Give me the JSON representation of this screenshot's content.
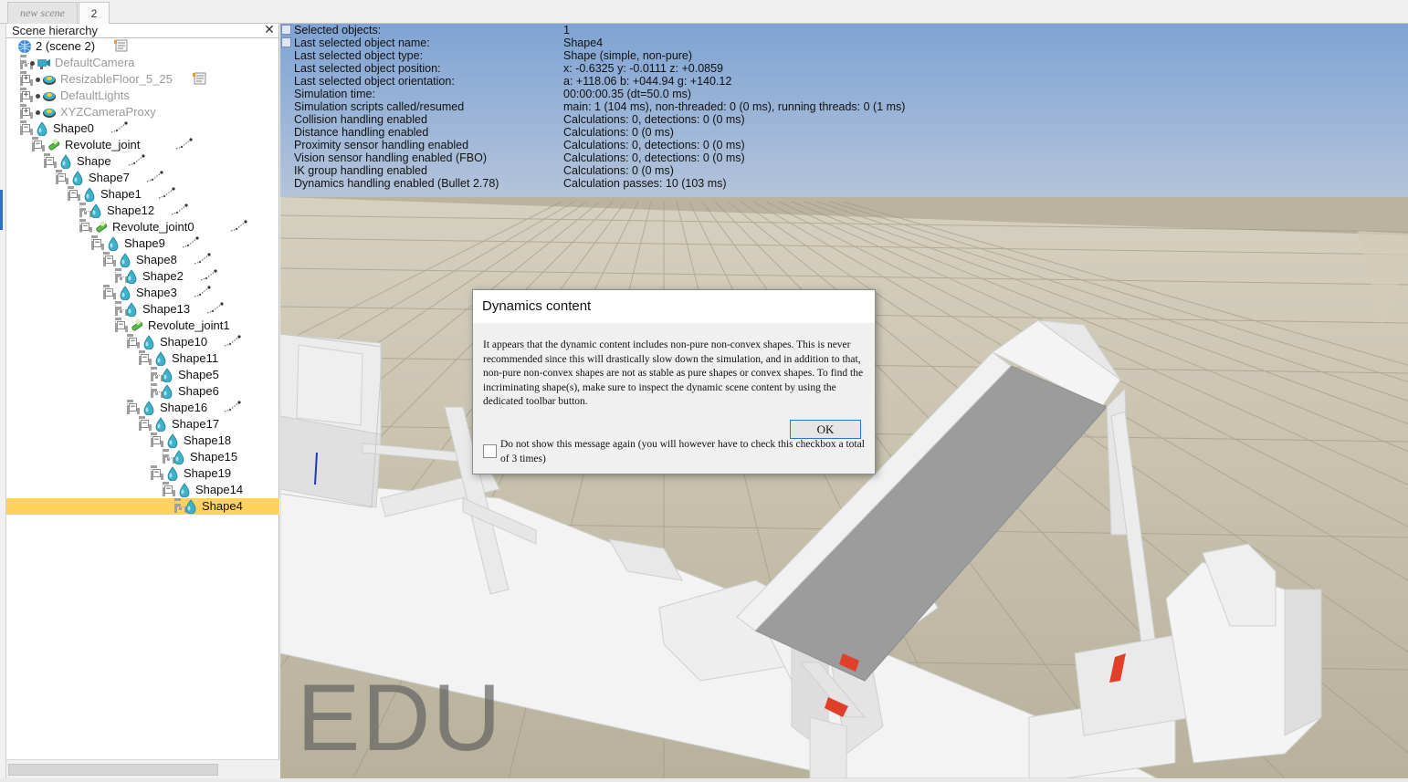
{
  "tabs": [
    {
      "label": "new scene",
      "active": false
    },
    {
      "label": "2",
      "active": true
    }
  ],
  "hierarchy": {
    "title": "Scene hierarchy",
    "close_label": "✕",
    "items": [
      {
        "label": "2 (scene 2)",
        "depth": 0,
        "icon": "scene-globe-icon",
        "expander": "",
        "grey": false,
        "extra_icon": "script-icon",
        "selected": false
      },
      {
        "label": "DefaultCamera",
        "depth": 1,
        "icon": "camera-icon",
        "expander": "",
        "grey": true,
        "extra_icon": "",
        "selected": false
      },
      {
        "label": "ResizableFloor_5_25",
        "depth": 1,
        "icon": "model-base-icon",
        "expander": "+",
        "grey": true,
        "extra_icon": "script-icon",
        "selected": false
      },
      {
        "label": "DefaultLights",
        "depth": 1,
        "icon": "model-base-icon",
        "expander": "+",
        "grey": true,
        "extra_icon": "",
        "selected": false
      },
      {
        "label": "XYZCameraProxy",
        "depth": 1,
        "icon": "model-base-icon",
        "expander": "+",
        "grey": true,
        "extra_icon": "",
        "selected": false
      },
      {
        "label": "Shape0",
        "depth": 1,
        "icon": "shape-icon",
        "expander": "−",
        "grey": false,
        "extra_icon": "path-icon",
        "selected": false
      },
      {
        "label": "Revolute_joint",
        "depth": 2,
        "icon": "joint-icon",
        "expander": "−",
        "grey": false,
        "extra_icon": "path-icon",
        "selected": false
      },
      {
        "label": "Shape",
        "depth": 3,
        "icon": "shape-icon",
        "expander": "−",
        "grey": false,
        "extra_icon": "path-icon",
        "selected": false
      },
      {
        "label": "Shape7",
        "depth": 4,
        "icon": "shape-icon",
        "expander": "−",
        "grey": false,
        "extra_icon": "path-icon",
        "selected": false
      },
      {
        "label": "Shape1",
        "depth": 5,
        "icon": "shape-icon",
        "expander": "−",
        "grey": false,
        "extra_icon": "path-icon",
        "selected": false
      },
      {
        "label": "Shape12",
        "depth": 6,
        "icon": "shape-icon",
        "expander": "",
        "grey": false,
        "extra_icon": "path-icon",
        "selected": false
      },
      {
        "label": "Revolute_joint0",
        "depth": 6,
        "icon": "joint-icon",
        "expander": "−",
        "grey": false,
        "extra_icon": "path-icon",
        "selected": false
      },
      {
        "label": "Shape9",
        "depth": 7,
        "icon": "shape-icon",
        "expander": "−",
        "grey": false,
        "extra_icon": "path-icon",
        "selected": false
      },
      {
        "label": "Shape8",
        "depth": 8,
        "icon": "shape-icon",
        "expander": "−",
        "grey": false,
        "extra_icon": "path-icon",
        "selected": false
      },
      {
        "label": "Shape2",
        "depth": 9,
        "icon": "shape-icon",
        "expander": "",
        "grey": false,
        "extra_icon": "path-icon",
        "selected": false
      },
      {
        "label": "Shape3",
        "depth": 8,
        "icon": "shape-icon",
        "expander": "−",
        "grey": false,
        "extra_icon": "path-icon",
        "selected": false
      },
      {
        "label": "Shape13",
        "depth": 9,
        "icon": "shape-icon",
        "expander": "",
        "grey": false,
        "extra_icon": "path-icon",
        "selected": false
      },
      {
        "label": "Revolute_joint1",
        "depth": 9,
        "icon": "joint-icon",
        "expander": "−",
        "grey": false,
        "extra_icon": "",
        "selected": false
      },
      {
        "label": "Shape10",
        "depth": 10,
        "icon": "shape-icon",
        "expander": "−",
        "grey": false,
        "extra_icon": "path-icon",
        "selected": false
      },
      {
        "label": "Shape11",
        "depth": 11,
        "icon": "shape-icon",
        "expander": "−",
        "grey": false,
        "extra_icon": "",
        "selected": false
      },
      {
        "label": "Shape5",
        "depth": 12,
        "icon": "shape-icon",
        "expander": "",
        "grey": false,
        "extra_icon": "",
        "selected": false
      },
      {
        "label": "Shape6",
        "depth": 12,
        "icon": "shape-icon",
        "expander": "",
        "grey": false,
        "extra_icon": "",
        "selected": false
      },
      {
        "label": "Shape16",
        "depth": 10,
        "icon": "shape-icon",
        "expander": "−",
        "grey": false,
        "extra_icon": "path-icon",
        "selected": false
      },
      {
        "label": "Shape17",
        "depth": 11,
        "icon": "shape-icon",
        "expander": "−",
        "grey": false,
        "extra_icon": "",
        "selected": false
      },
      {
        "label": "Shape18",
        "depth": 12,
        "icon": "shape-icon",
        "expander": "−",
        "grey": false,
        "extra_icon": "",
        "selected": false
      },
      {
        "label": "Shape15",
        "depth": 13,
        "icon": "shape-icon",
        "expander": "",
        "grey": false,
        "extra_icon": "",
        "selected": false
      },
      {
        "label": "Shape19",
        "depth": 12,
        "icon": "shape-icon",
        "expander": "−",
        "grey": false,
        "extra_icon": "",
        "selected": false
      },
      {
        "label": "Shape14",
        "depth": 13,
        "icon": "shape-icon",
        "expander": "−",
        "grey": false,
        "extra_icon": "",
        "selected": false
      },
      {
        "label": "Shape4",
        "depth": 14,
        "icon": "shape-icon",
        "expander": "",
        "grey": false,
        "extra_icon": "",
        "selected": true
      }
    ]
  },
  "info_overlay": {
    "rows": [
      {
        "key": "Selected objects:",
        "value": "1",
        "button": "-"
      },
      {
        "key": "Last selected object name:",
        "value": "Shape4",
        "button": ""
      },
      {
        "key": "Last selected object type:",
        "value": "Shape (simple, non-pure)",
        "button": ""
      },
      {
        "key": "Last selected object position:",
        "value": "x: -0.6325    y: -0.0111    z: +0.0859",
        "button": ""
      },
      {
        "key": "Last selected object orientation:",
        "value": "a: +118.06    b: +044.94    g: +140.12",
        "button": ""
      },
      {
        "key": "Simulation time:",
        "value": "00:00:00.35 (dt=50.0 ms)",
        "button": ""
      },
      {
        "key": "Simulation scripts called/resumed",
        "value": "main: 1 (104 ms), non-threaded: 0 (0 ms), running threads: 0 (1 ms)",
        "button": ""
      },
      {
        "key": "Collision handling enabled",
        "value": "Calculations: 0, detections: 0 (0 ms)",
        "button": ""
      },
      {
        "key": "Distance handling enabled",
        "value": "Calculations: 0 (0 ms)",
        "button": ""
      },
      {
        "key": "Proximity sensor handling enabled",
        "value": "Calculations: 0, detections: 0 (0 ms)",
        "button": ""
      },
      {
        "key": "Vision sensor handling enabled (FBO)",
        "value": "Calculations: 0, detections: 0 (0 ms)",
        "button": ""
      },
      {
        "key": "IK group handling enabled",
        "value": "Calculations: 0 (0 ms)",
        "button": ""
      },
      {
        "key": "Dynamics handling enabled (Bullet 2.78)",
        "value": "Calculation passes: 10 (103 ms)",
        "button": ""
      }
    ]
  },
  "watermark": "EDU",
  "dialog": {
    "title": "Dynamics content",
    "message": "It appears that the dynamic content includes non-pure non-convex shapes. This is never recommended since this will drastically slow down the simulation, and in addition to that, non-pure non-convex shapes are not as stable as pure shapes or convex shapes. To find the incriminating shape(s), make sure to inspect the dynamic scene content by using the dedicated toolbar button.",
    "ok_label": "OK",
    "checkbox_label": "Do not show this message again (you will however have to check this checkbox a total of 3 times)",
    "checkbox_checked": false
  },
  "colors": {
    "selection": "#ffd35c",
    "sky_top": "#7fa3d4",
    "sky_bottom": "#b4c4da",
    "floor": "#c9c2ae",
    "shape_icon": "#3fb1c8",
    "joint_icon": "#5ab84a",
    "ok_border": "#2c77d4"
  }
}
